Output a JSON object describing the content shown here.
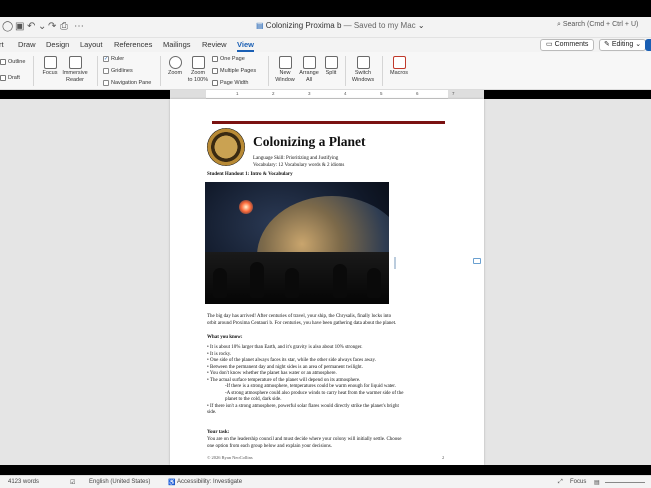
{
  "window": {
    "doc_title": "Colonizing Proxima b",
    "saved_status": "— Saved to my Mac",
    "search_placeholder": "Search (Cmd + Ctrl + U)"
  },
  "tabs": [
    "rt",
    "Draw",
    "Design",
    "Layout",
    "References",
    "Mailings",
    "Review",
    "View"
  ],
  "active_tab": "View",
  "header_buttons": {
    "comments": "Comments",
    "editing": "Editing"
  },
  "ribbon": {
    "outline": "Outline",
    "draft": "Draft",
    "focus": "Focus",
    "immersive_reader_1": "Immersive",
    "immersive_reader_2": "Reader",
    "ruler": "Ruler",
    "gridlines": "Gridlines",
    "navigation_pane": "Navigation Pane",
    "zoom": "Zoom",
    "zoom100_1": "Zoom",
    "zoom100_2": "to 100%",
    "one_page": "One Page",
    "multiple_pages": "Multiple Pages",
    "page_width": "Page Width",
    "new_window_1": "New",
    "new_window_2": "Window",
    "arrange_all_1": "Arrange",
    "arrange_all_2": "All",
    "split": "Split",
    "switch_windows_1": "Switch",
    "switch_windows_2": "Windows",
    "macros": "Macros"
  },
  "ruler_numbers": [
    "1",
    "2",
    "3",
    "4",
    "5",
    "6",
    "7"
  ],
  "document": {
    "title": "Colonizing a Planet",
    "skill": "Language Skill: Prioritizing and Justifying",
    "vocab": "Vocabulary: 12 Vocabulary words & 2 idioms",
    "handout": "Student Handout 1: Intro & Vocabulary",
    "intro_1": "The big day has arrived! After centuries of travel, your ship, the Chrysalis, finally locks into",
    "intro_2": "orbit around Proxima Centauri b. For centuries, you have been gathering data about the planet.",
    "what_you_know": "What you know:",
    "bullets": [
      "• It is about 10% larger than Earth, and it's gravity is also about 10% stronger.",
      "• It is rocky.",
      "• One side of the planet always faces its star, while the other side always faces away.",
      "• Between the permanent day and night sides is an area of permanent twilight.",
      "• You don't know whether the planet has water or an atmosphere.",
      "• The actual surface temperature of the planet will depend on its atmosphere."
    ],
    "sub_bullets": [
      "-If there is a strong atmosphere, temperatures could be warm enough for liquid water.",
      "-A strong atmosphere could also produce winds to carry heat from the warmer side of the",
      "planet to the cold, dark side."
    ],
    "last_bullet_1": "• If there isn't a strong atmosphere, powerful solar flares would directly strike the planet's bright",
    "last_bullet_2": "side.",
    "your_task": "Your task:",
    "task_1": "You are on the leadership council and must decide where your colony will initially settle. Choose",
    "task_2": "one option from each group below and explain your decisions.",
    "footer_left": "© 2026 Ryan NeoCollins",
    "footer_right": "2"
  },
  "statusbar": {
    "words": "4123 words",
    "language": "English (United States)",
    "accessibility": "Accessibility: Investigate",
    "focus": "Focus"
  },
  "colors": {
    "accent": "#1a5fb4",
    "title_bar": "#7a1111"
  }
}
